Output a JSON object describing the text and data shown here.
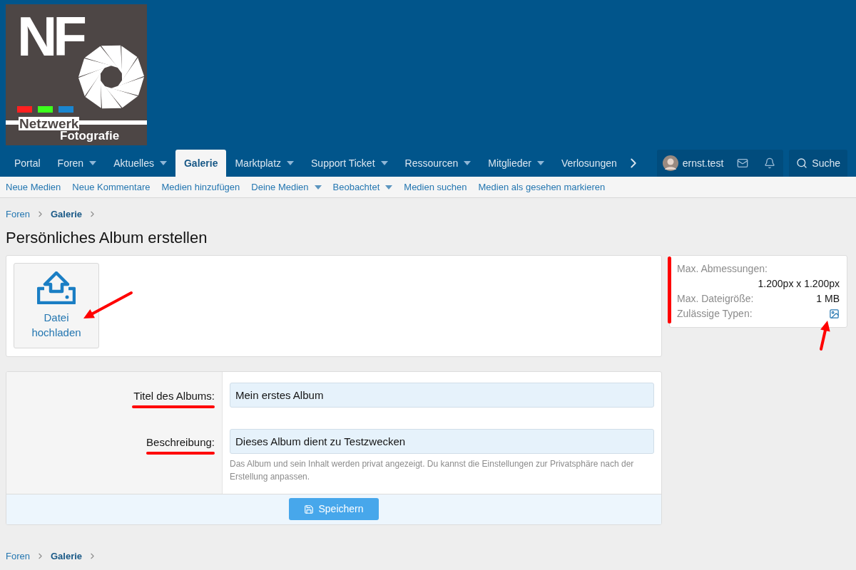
{
  "logo": {
    "initials": "NF",
    "line_1": "Netzwerk",
    "line_2": "Fotografie"
  },
  "nav": {
    "tabs": [
      {
        "label": "Portal",
        "selected": false,
        "has_menu": false
      },
      {
        "label": "Foren",
        "selected": false,
        "has_menu": true
      },
      {
        "label": "Aktuelles",
        "selected": false,
        "has_menu": true
      },
      {
        "label": "Galerie",
        "selected": true,
        "has_menu": false
      },
      {
        "label": "Marktplatz",
        "selected": false,
        "has_menu": true
      },
      {
        "label": "Support Ticket",
        "selected": false,
        "has_menu": true
      },
      {
        "label": "Ressourcen",
        "selected": false,
        "has_menu": true
      },
      {
        "label": "Mitglieder",
        "selected": false,
        "has_menu": true
      },
      {
        "label": "Verlosungen",
        "selected": false,
        "has_menu": false
      }
    ],
    "user": "ernst.test",
    "search": "Suche"
  },
  "subnav": [
    {
      "label": "Neue Medien",
      "has_menu": false
    },
    {
      "label": "Neue Kommentare",
      "has_menu": false
    },
    {
      "label": "Medien hinzufügen",
      "has_menu": false
    },
    {
      "label": "Deine Medien",
      "has_menu": true
    },
    {
      "label": "Beobachtet",
      "has_menu": true
    },
    {
      "label": "Medien suchen",
      "has_menu": false
    },
    {
      "label": "Medien als gesehen markieren",
      "has_menu": false
    }
  ],
  "breadcrumb": [
    "Foren",
    "Galerie"
  ],
  "title": "Persönliches Album erstellen",
  "upload": {
    "label": "Datei hochladen"
  },
  "limits": [
    {
      "kind": "stacked",
      "label": "Max. Abmessungen:",
      "value": "1.200px x 1.200px"
    },
    {
      "kind": "inline",
      "label": "Max. Dateigröße:",
      "value": "1 MB"
    },
    {
      "kind": "icon",
      "label": "Zulässige Typen:"
    }
  ],
  "form": {
    "fields": [
      {
        "label": "Titel des Albums:",
        "value": "Mein erstes Album"
      },
      {
        "label": "Beschreibung:",
        "value": "Dieses Album dient zu Testzwecken",
        "hint": "Das Album und sein Inhalt werden privat angezeigt. Du kannst die Einstellungen zur Privatsphäre nach der Erstellung anpassen."
      }
    ],
    "submit": "Speichern"
  },
  "footer_breadcrumb": [
    "Foren",
    "Galerie"
  ]
}
